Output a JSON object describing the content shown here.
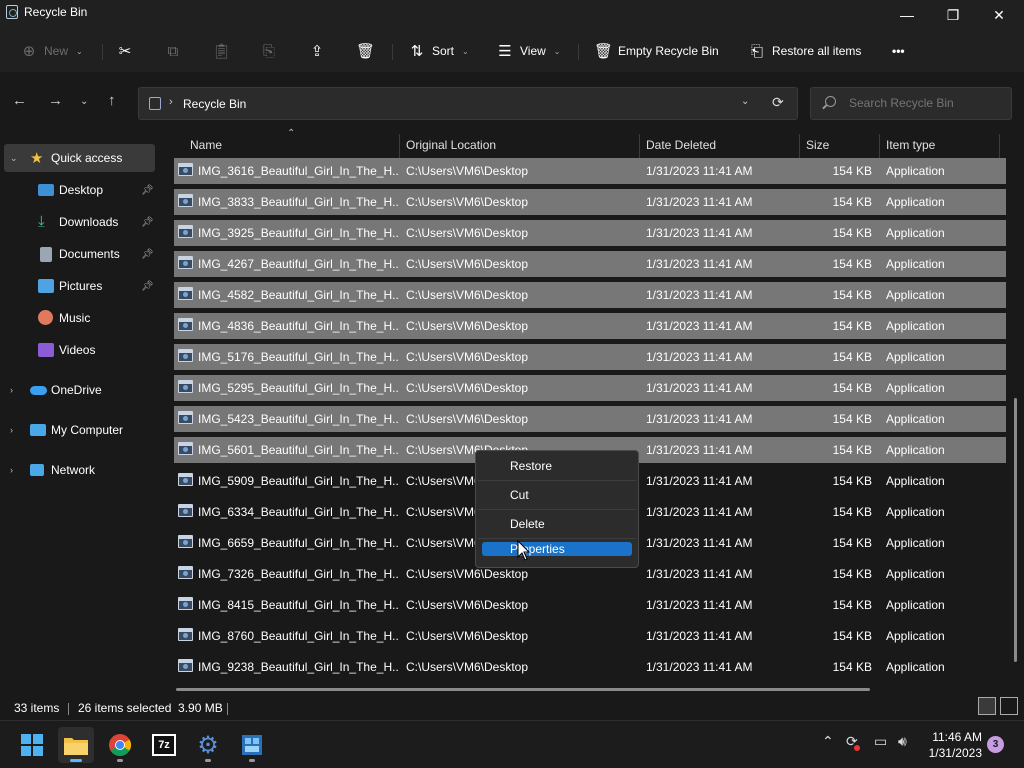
{
  "window": {
    "title": "Recycle Bin",
    "minimize_icon": "—",
    "maximize_icon": "❐",
    "close_icon": "✕"
  },
  "toolbar": {
    "new_label": "New",
    "sort_label": "Sort",
    "view_label": "View",
    "empty_label": "Empty Recycle Bin",
    "restore_all_label": "Restore all items",
    "more_label": "•••"
  },
  "address": {
    "path": "Recycle Bin"
  },
  "search": {
    "placeholder": "Search Recycle Bin"
  },
  "sidebar": {
    "items": [
      {
        "label": "Quick access"
      },
      {
        "label": "Desktop"
      },
      {
        "label": "Downloads"
      },
      {
        "label": "Documents"
      },
      {
        "label": "Pictures"
      },
      {
        "label": "Music"
      },
      {
        "label": "Videos"
      },
      {
        "label": "OneDrive"
      },
      {
        "label": "My Computer"
      },
      {
        "label": "Network"
      }
    ]
  },
  "columns": [
    "Name",
    "Original Location",
    "Date Deleted",
    "Size",
    "Item type"
  ],
  "rows": [
    {
      "name": "IMG_3616_Beautiful_Girl_In_The_H...",
      "location": "C:\\Users\\VM6\\Desktop",
      "date": "1/31/2023 11:41 AM",
      "size": "154 KB",
      "type": "Application",
      "selected": true
    },
    {
      "name": "IMG_3833_Beautiful_Girl_In_The_H...",
      "location": "C:\\Users\\VM6\\Desktop",
      "date": "1/31/2023 11:41 AM",
      "size": "154 KB",
      "type": "Application",
      "selected": true
    },
    {
      "name": "IMG_3925_Beautiful_Girl_In_The_H...",
      "location": "C:\\Users\\VM6\\Desktop",
      "date": "1/31/2023 11:41 AM",
      "size": "154 KB",
      "type": "Application",
      "selected": true
    },
    {
      "name": "IMG_4267_Beautiful_Girl_In_The_H...",
      "location": "C:\\Users\\VM6\\Desktop",
      "date": "1/31/2023 11:41 AM",
      "size": "154 KB",
      "type": "Application",
      "selected": true
    },
    {
      "name": "IMG_4582_Beautiful_Girl_In_The_H...",
      "location": "C:\\Users\\VM6\\Desktop",
      "date": "1/31/2023 11:41 AM",
      "size": "154 KB",
      "type": "Application",
      "selected": true
    },
    {
      "name": "IMG_4836_Beautiful_Girl_In_The_H...",
      "location": "C:\\Users\\VM6\\Desktop",
      "date": "1/31/2023 11:41 AM",
      "size": "154 KB",
      "type": "Application",
      "selected": true
    },
    {
      "name": "IMG_5176_Beautiful_Girl_In_The_H...",
      "location": "C:\\Users\\VM6\\Desktop",
      "date": "1/31/2023 11:41 AM",
      "size": "154 KB",
      "type": "Application",
      "selected": true
    },
    {
      "name": "IMG_5295_Beautiful_Girl_In_The_H...",
      "location": "C:\\Users\\VM6\\Desktop",
      "date": "1/31/2023 11:41 AM",
      "size": "154 KB",
      "type": "Application",
      "selected": true
    },
    {
      "name": "IMG_5423_Beautiful_Girl_In_The_H...",
      "location": "C:\\Users\\VM6\\Desktop",
      "date": "1/31/2023 11:41 AM",
      "size": "154 KB",
      "type": "Application",
      "selected": true
    },
    {
      "name": "IMG_5601_Beautiful_Girl_In_The_H...",
      "location": "C:\\Users\\VM6\\Desktop",
      "date": "1/31/2023 11:41 AM",
      "size": "154 KB",
      "type": "Application",
      "selected": true
    },
    {
      "name": "IMG_5909_Beautiful_Girl_In_The_H...",
      "location": "C:\\Users\\VM6\\Desktop",
      "date": "1/31/2023 11:41 AM",
      "size": "154 KB",
      "type": "Application",
      "selected": false
    },
    {
      "name": "IMG_6334_Beautiful_Girl_In_The_H...",
      "location": "C:\\Users\\VM6\\Desktop",
      "date": "1/31/2023 11:41 AM",
      "size": "154 KB",
      "type": "Application",
      "selected": false
    },
    {
      "name": "IMG_6659_Beautiful_Girl_In_The_H...",
      "location": "C:\\Users\\VM6\\Desktop",
      "date": "1/31/2023 11:41 AM",
      "size": "154 KB",
      "type": "Application",
      "selected": false
    },
    {
      "name": "IMG_7326_Beautiful_Girl_In_The_H...",
      "location": "C:\\Users\\VM6\\Desktop",
      "date": "1/31/2023 11:41 AM",
      "size": "154 KB",
      "type": "Application",
      "selected": false
    },
    {
      "name": "IMG_8415_Beautiful_Girl_In_The_H...",
      "location": "C:\\Users\\VM6\\Desktop",
      "date": "1/31/2023 11:41 AM",
      "size": "154 KB",
      "type": "Application",
      "selected": false
    },
    {
      "name": "IMG_8760_Beautiful_Girl_In_The_H...",
      "location": "C:\\Users\\VM6\\Desktop",
      "date": "1/31/2023 11:41 AM",
      "size": "154 KB",
      "type": "Application",
      "selected": false
    },
    {
      "name": "IMG_9238_Beautiful_Girl_In_The_H...",
      "location": "C:\\Users\\VM6\\Desktop",
      "date": "1/31/2023 11:41 AM",
      "size": "154 KB",
      "type": "Application",
      "selected": false
    }
  ],
  "context_menu": {
    "items": [
      {
        "label": "Restore",
        "highlighted": false
      },
      {
        "label": "Cut",
        "highlighted": false
      },
      {
        "label": "Delete",
        "highlighted": false
      },
      {
        "label": "Properties",
        "highlighted": true
      }
    ]
  },
  "status": {
    "count": "33 items",
    "selection": "26 items selected  3.90 MB"
  },
  "taskbar": {
    "clock_time": "11:46 AM",
    "clock_date": "1/31/2023",
    "notification_count": "3",
    "sevenzip_label": "7z"
  },
  "colors": {
    "selected_row": "#777777",
    "menu_highlight": "#1a73c9",
    "accent": "#5eb5f7"
  }
}
